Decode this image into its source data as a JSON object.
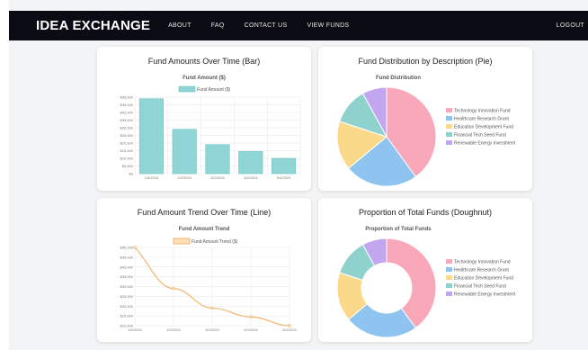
{
  "nav": {
    "brand": "IDEA EXCHANGE",
    "links": [
      "ABOUT",
      "FAQ",
      "CONTACT US",
      "VIEW FUNDS"
    ],
    "logout": "LOGOUT"
  },
  "colors": {
    "bar_fill": "#90d5d5",
    "bar_stroke": "#5fbcbc",
    "line": "#f0b66e",
    "slice_colors": [
      "#f8a8b8",
      "#8ec4ef",
      "#fbd98a",
      "#8fd1cc",
      "#c2a6f0"
    ]
  },
  "cards": {
    "bar": {
      "title": "Fund Amounts Over Time (Bar)",
      "chart_title": "Fund Amount ($)",
      "legend": "Fund Amount ($)"
    },
    "pie": {
      "title": "Fund Distribution by Description (Pie)",
      "chart_title": "Fund Distribution"
    },
    "line": {
      "title": "Fund Amount Trend Over Time (Line)",
      "chart_title": "Fund Amount Trend",
      "legend": "Fund Amount Trend ($)"
    },
    "doughnut": {
      "title": "Proportion of Total Funds (Doughnut)",
      "chart_title": "Proportion of Total Funds"
    }
  },
  "chart_data": [
    {
      "type": "bar",
      "title": "Fund Amount ($)",
      "categories": [
        "1/6/2024",
        "2/2/2024",
        "3/2/2024",
        "4/4/2024",
        "5/4/2024"
      ],
      "values": [
        49000,
        29000,
        19000,
        14500,
        10000
      ],
      "ylim": [
        0,
        50000
      ],
      "yticks": [
        "$0",
        "$5,000",
        "$10,000",
        "$15,000",
        "$20,000",
        "$25,000",
        "$30,000",
        "$35,000",
        "$40,000",
        "$45,000",
        "$50,000"
      ],
      "legend": "Fund Amount ($)"
    },
    {
      "type": "pie",
      "title": "Fund Distribution",
      "labels": [
        "Technology Innovation Fund",
        "Healthcare Research Grant",
        "Education Development Fund",
        "Financial Tech Seed Fund",
        "Renewable Energy Investment"
      ],
      "values": [
        40,
        24,
        16,
        12,
        8
      ],
      "legend_position": "right"
    },
    {
      "type": "line",
      "title": "Fund Amount Trend",
      "categories": [
        "1/6/2024",
        "2/2/2024",
        "3/2/2024",
        "4/4/2024",
        "5/4/2024"
      ],
      "values": [
        50000,
        29000,
        19000,
        14500,
        10000
      ],
      "ylim": [
        10000,
        50000
      ],
      "yticks": [
        "$10,000",
        "$15,000",
        "$20,000",
        "$25,000",
        "$30,000",
        "$35,000",
        "$40,000",
        "$45,000",
        "$50,000"
      ],
      "legend": "Fund Amount Trend ($)"
    },
    {
      "type": "pie",
      "subtype": "doughnut",
      "title": "Proportion of Total Funds",
      "labels": [
        "Technology Innovation Fund",
        "Healthcare Research Grant",
        "Education Development Fund",
        "Financial Tech Seed Fund",
        "Renewable Energy Investment"
      ],
      "values": [
        40,
        24,
        16,
        12,
        8
      ],
      "legend_position": "right"
    }
  ]
}
